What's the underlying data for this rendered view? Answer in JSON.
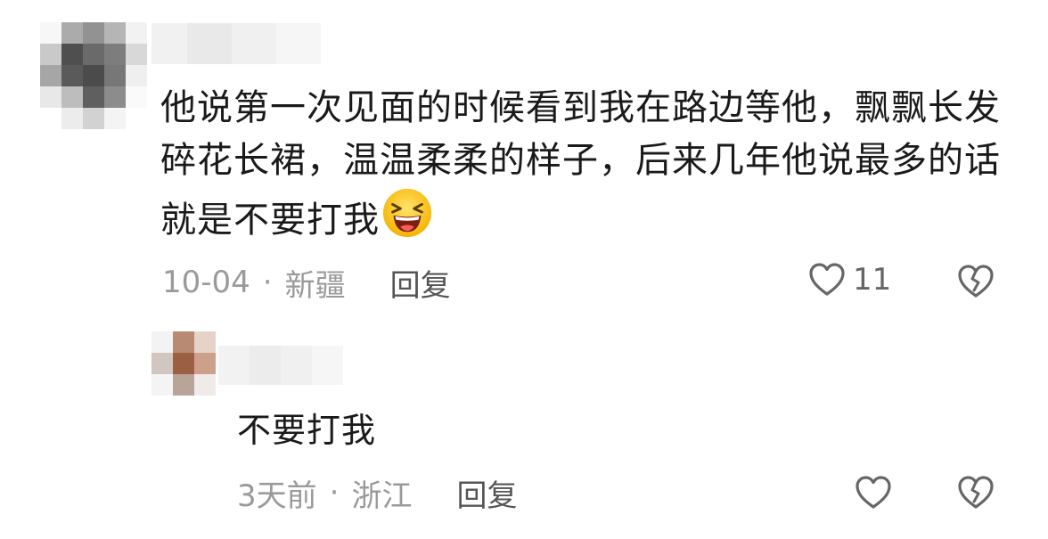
{
  "comment": {
    "text": "他说第一次见面的时候看到我在路边等他，飘飘长发碎花长裙，温温柔柔的样子，后来几年他说最多的话就是不要打我",
    "emoji": "laughing-squinting-emoji",
    "date": "10-04",
    "separator": "·",
    "location": "新疆",
    "reply_label": "回复",
    "like_count": "11"
  },
  "reply": {
    "text": "不要打我",
    "date": "3天前",
    "separator": "·",
    "location": "浙江",
    "reply_label": "回复"
  },
  "colors": {
    "text": "#1a1a1a",
    "meta": "#9a9a9a",
    "icon_stroke": "#666666"
  },
  "icons": [
    "heart-icon",
    "broken-heart-icon"
  ]
}
